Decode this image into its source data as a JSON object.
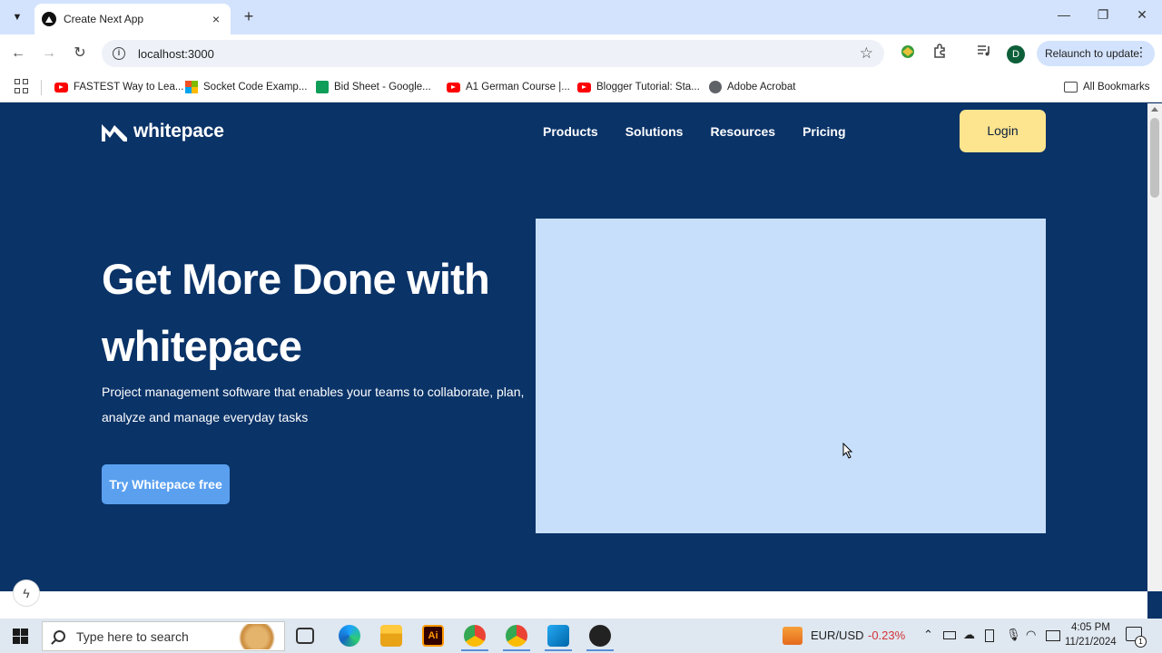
{
  "browser": {
    "tab": {
      "title": "Create Next App",
      "favicon": "nextjs-icon",
      "close": "×"
    },
    "new_tab": "+",
    "window_controls": {
      "minimize": "—",
      "restore": "❐",
      "close": "✕"
    },
    "url": "localhost:3000",
    "profile_initial": "D",
    "relaunch_label": "Relaunch to update",
    "more_label": "⋮",
    "bookmarks": [
      {
        "label": "FASTEST Way to Lea...",
        "icon": "youtube-icon"
      },
      {
        "label": "Socket Code Examp...",
        "icon": "microsoft-icon"
      },
      {
        "label": "Bid Sheet - Google...",
        "icon": "google-sheets-icon"
      },
      {
        "label": "A1 German Course |...",
        "icon": "youtube-icon"
      },
      {
        "label": "Blogger Tutorial: Sta...",
        "icon": "youtube-icon"
      },
      {
        "label": "Adobe Acrobat",
        "icon": "globe-icon"
      }
    ],
    "all_bookmarks": "All Bookmarks"
  },
  "site": {
    "logo_text": "whitepace",
    "nav": [
      "Products",
      "Solutions",
      "Resources",
      "Pricing"
    ],
    "login_label": "Login",
    "hero": {
      "title": "Get More Done with whitepace",
      "subtitle": "Project management software that enables your teams to collaborate, plan, analyze and manage everyday tasks",
      "cta_label": "Try Whitepace free"
    },
    "colors": {
      "background": "#0a3368",
      "login_button": "#fde48e",
      "cta_button": "#5aa0ef",
      "hero_image_placeholder": "#c7dffa"
    }
  },
  "taskbar": {
    "search_placeholder": "Type here to search",
    "fx_pair": "EUR/USD",
    "fx_change": "-0.23%",
    "time": "4:05 PM",
    "date": "11/21/2024",
    "notification_count": "1"
  }
}
